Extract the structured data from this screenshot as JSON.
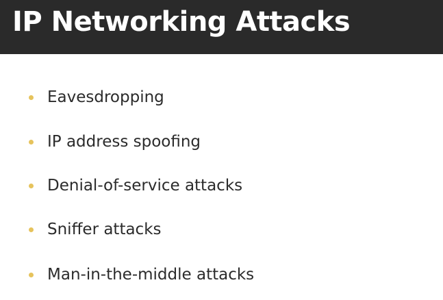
{
  "slide": {
    "title": "IP Networking Attacks",
    "bullets": [
      "Eavesdropping",
      "IP address spoofing",
      "Denial-of-service attacks",
      "Sniffer attacks",
      "Man-in-the-middle attacks"
    ]
  },
  "colors": {
    "title_bar": "#2a2a2a",
    "title_text": "#ffffff",
    "bullet_marker": "#e6c35c",
    "body_text": "#2b2b2b",
    "background": "#ffffff"
  },
  "icons": {
    "bullet": "bullet-dot-icon"
  }
}
